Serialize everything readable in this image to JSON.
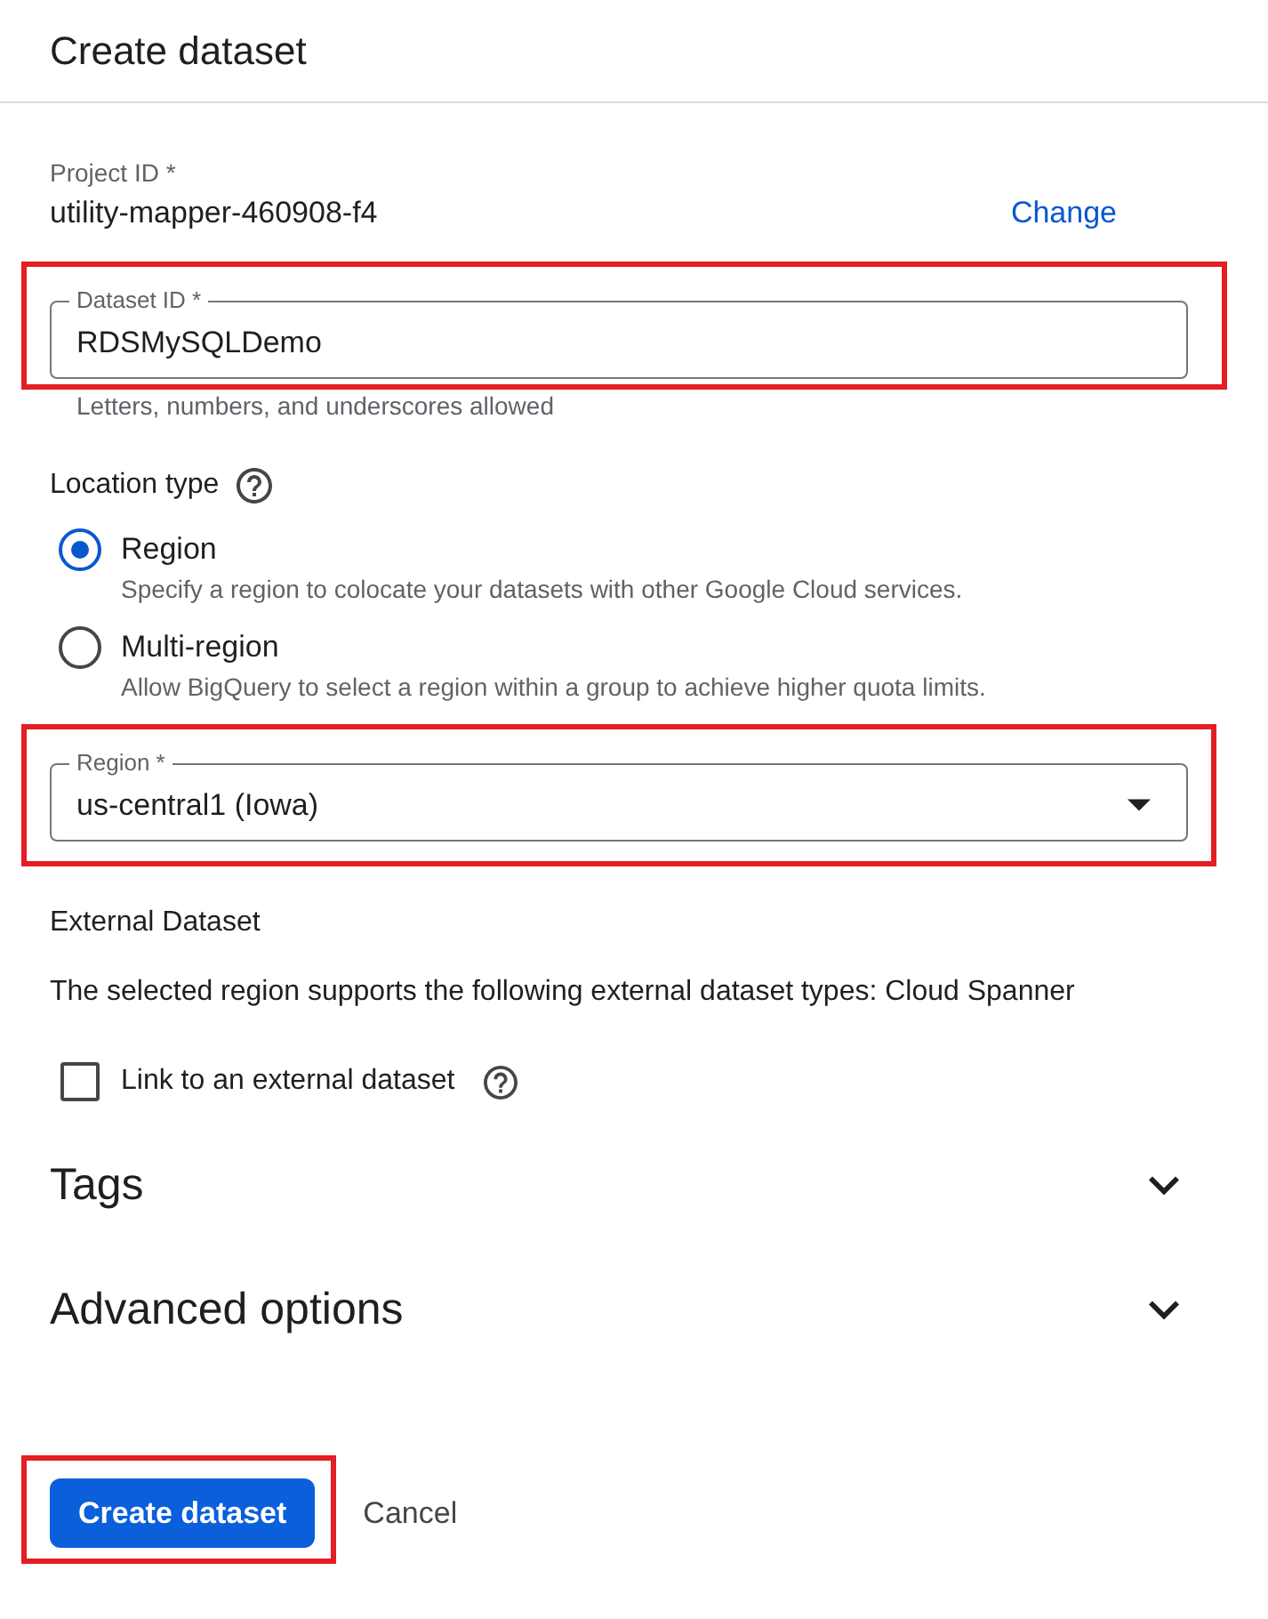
{
  "title": "Create dataset",
  "project": {
    "label": "Project ID *",
    "value": "utility-mapper-460908-f4",
    "change_link": "Change"
  },
  "dataset_id": {
    "label": "Dataset ID *",
    "value": "RDSMySQLDemo",
    "hint": "Letters, numbers, and underscores allowed",
    "highlighted": true
  },
  "location_type": {
    "label": "Location type",
    "options": [
      {
        "label": "Region",
        "description": "Specify a region to colocate your datasets with other Google Cloud services.",
        "selected": true
      },
      {
        "label": "Multi-region",
        "description": "Allow BigQuery to select a region within a group to achieve higher quota limits.",
        "selected": false
      }
    ]
  },
  "region": {
    "label": "Region *",
    "value": "us-central1 (Iowa)",
    "highlighted": true
  },
  "external_dataset": {
    "heading": "External Dataset",
    "description": "The selected region supports the following external dataset types: Cloud Spanner",
    "checkbox": {
      "label": "Link to an external dataset",
      "checked": false
    }
  },
  "sections": [
    {
      "title": "Tags",
      "expanded": false
    },
    {
      "title": "Advanced options",
      "expanded": false
    }
  ],
  "buttons": [
    {
      "label": "Create dataset",
      "kind": "primary",
      "highlighted": true
    },
    {
      "label": "Cancel",
      "kind": "text",
      "highlighted": false
    }
  ]
}
